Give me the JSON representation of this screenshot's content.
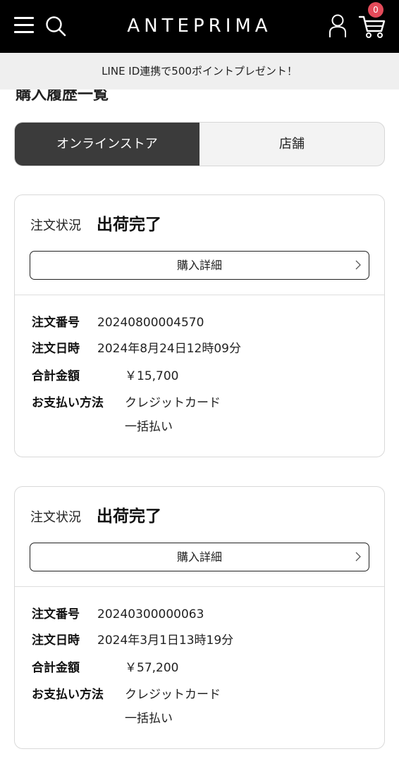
{
  "header": {
    "logo": "ANTEPRIMA",
    "cart_count": "0",
    "icons": [
      "menu-icon",
      "search-icon",
      "user-icon",
      "cart-icon"
    ]
  },
  "notice": {
    "text": "LINE ID連携で500ポイントプレゼント！"
  },
  "page": {
    "title": "購入履歴一覧"
  },
  "tabs": [
    {
      "label": "オンラインストア",
      "active": true
    },
    {
      "label": "店舗",
      "active": false
    }
  ],
  "orders": [
    {
      "status_label": "注文状況",
      "status_value": "出荷完了",
      "detail_button": "購入詳細",
      "order_number_label": "注文番号",
      "order_number": "20240800004570",
      "order_date_label": "注文日時",
      "order_date": "2024年8月24日12時09分",
      "total_label": "合計金額",
      "total": "￥15,700",
      "payment_label": "お支払い方法",
      "payment_method": "クレジットカード",
      "payment_type": "一括払い"
    },
    {
      "status_label": "注文状況",
      "status_value": "出荷完了",
      "detail_button": "購入詳細",
      "order_number_label": "注文番号",
      "order_number": "20240300000063",
      "order_date_label": "注文日時",
      "order_date": "2024年3月1日13時19分",
      "total_label": "合計金額",
      "total": "￥57,200",
      "payment_label": "お支払い方法",
      "payment_method": "クレジットカード",
      "payment_type": "一括払い"
    }
  ]
}
